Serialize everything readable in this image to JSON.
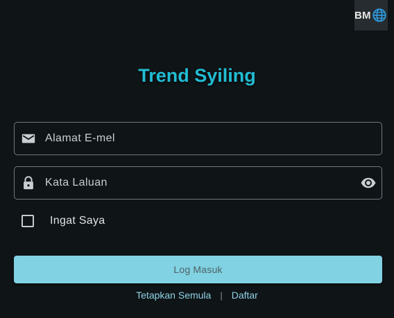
{
  "language": {
    "label": "BM",
    "icon": "globe-icon"
  },
  "app": {
    "title": "Trend Syiling",
    "accent_color": "#21bcd3"
  },
  "form": {
    "email": {
      "placeholder": "Alamat E-mel",
      "value": "",
      "icon": "mail-icon"
    },
    "password": {
      "placeholder": "Kata Laluan",
      "value": "",
      "icon": "lock-icon",
      "toggle_icon": "eye-icon"
    },
    "remember": {
      "label": "Ingat Saya",
      "checked": false
    },
    "submit_label": "Log Masuk",
    "submit_color": "#81d2e2"
  },
  "links": {
    "reset_label": "Tetapkan Semula",
    "separator": "|",
    "register_label": "Daftar"
  }
}
